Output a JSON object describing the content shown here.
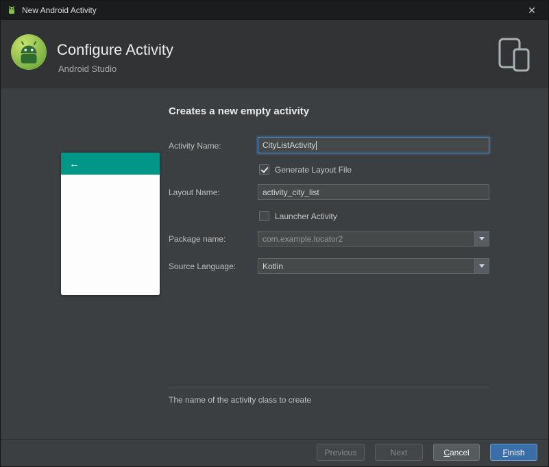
{
  "window": {
    "title": "New Android Activity"
  },
  "icons": {
    "close": "✕",
    "back_arrow": "←"
  },
  "header": {
    "title": "Configure Activity",
    "subtitle": "Android Studio"
  },
  "content": {
    "heading": "Creates a new empty activity",
    "fields": {
      "activity_name": {
        "label": "Activity Name:",
        "value": "CityListActivity"
      },
      "generate_layout_file": {
        "label": "Generate Layout File",
        "checked": true
      },
      "layout_name": {
        "label": "Layout Name:",
        "value": "activity_city_list"
      },
      "launcher_activity": {
        "label": "Launcher Activity",
        "checked": false
      },
      "package_name": {
        "label": "Package name:",
        "value": "com.example.locator2"
      },
      "source_language": {
        "label": "Source Language:",
        "value": "Kotlin"
      }
    },
    "hint": "The name of the activity class to create"
  },
  "footer": {
    "previous": "Previous",
    "next": "Next",
    "cancel": {
      "mnemonic": "C",
      "rest": "ancel"
    },
    "finish": {
      "mnemonic": "F",
      "rest": "inish"
    }
  },
  "colors": {
    "accent_teal": "#009688",
    "focus_blue": "#4d87c7",
    "primary_button_blue": "#3a6ea8",
    "header_background": "#313335",
    "body_background": "#3c3f41"
  }
}
